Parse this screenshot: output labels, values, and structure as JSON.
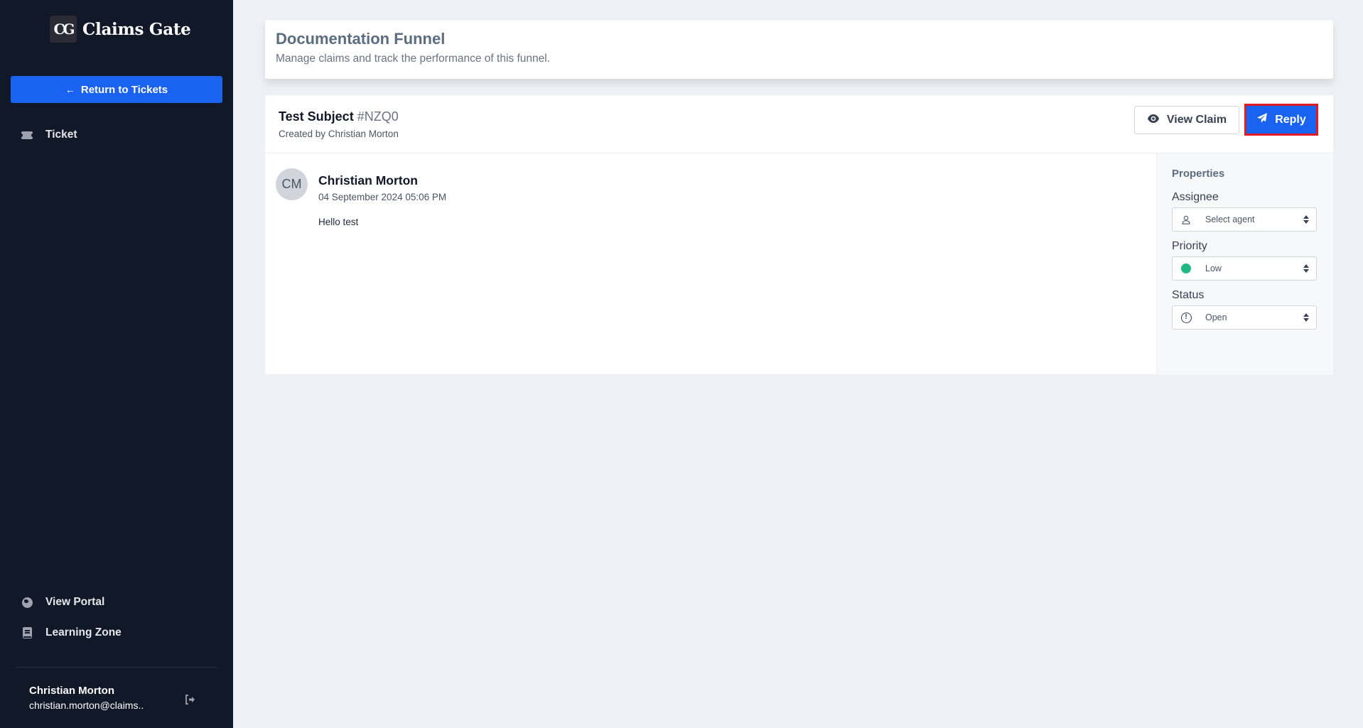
{
  "sidebar": {
    "logo_mark": "CG",
    "brand": "Claims Gate",
    "return_button": {
      "icon": "arrow-left-icon",
      "label": "Return to Tickets"
    },
    "nav_top": [
      {
        "icon": "ticket-icon",
        "label": "Ticket"
      }
    ],
    "nav_bottom": [
      {
        "icon": "globe-icon",
        "label": "View Portal"
      },
      {
        "icon": "book-icon",
        "label": "Learning Zone"
      }
    ],
    "user": {
      "name": "Christian Morton",
      "email": "christian.morton@claims.."
    },
    "logout_icon": "sign-out-icon"
  },
  "header": {
    "title": "Documentation Funnel",
    "subtitle": "Manage claims and track the performance of this funnel."
  },
  "ticket": {
    "subject": "Test Subject",
    "ref": "#NZQ0",
    "created_by": "Created by Christian Morton",
    "actions": {
      "view_claim": {
        "icon": "eye-icon",
        "label": "View Claim"
      },
      "reply": {
        "icon": "paper-plane-icon",
        "label": "Reply",
        "highlight_color": "#e01b24"
      }
    },
    "messages": [
      {
        "avatar_initials": "CM",
        "author": "Christian Morton",
        "date": "04 September 2024 05:06 PM",
        "text": "Hello test"
      }
    ]
  },
  "properties": {
    "title": "Properties",
    "assignee": {
      "label": "Assignee",
      "icon": "user-icon",
      "value": "Select agent"
    },
    "priority": {
      "label": "Priority",
      "icon": "green-dot-icon",
      "value": "Low",
      "color": "#22b884"
    },
    "status": {
      "label": "Status",
      "icon": "alert-circle-icon",
      "value": "Open"
    }
  },
  "colors": {
    "sidebar_bg": "#111827",
    "primary": "#1a62f0",
    "page_bg": "#edf0f5"
  }
}
